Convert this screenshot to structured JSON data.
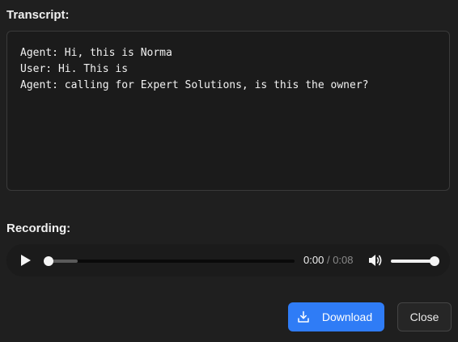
{
  "transcript": {
    "label": "Transcript:",
    "lines": [
      "Agent: Hi, this is Norma",
      "User: Hi. This is",
      "Agent: calling for Expert Solutions, is this the owner?"
    ]
  },
  "recording": {
    "label": "Recording:",
    "current_time": "0:00",
    "separator": "/",
    "total_time": "0:08",
    "progress_fraction": 0.0,
    "buffered_fraction": 0.12,
    "volume_fraction": 1.0,
    "play_icon": "play-icon",
    "volume_icon": "volume-icon"
  },
  "actions": {
    "download_label": "Download",
    "download_icon": "download-icon",
    "close_label": "Close"
  },
  "colors": {
    "background": "#1f1f1f",
    "panel": "#1b1b1b",
    "primary": "#2f7cf6"
  }
}
